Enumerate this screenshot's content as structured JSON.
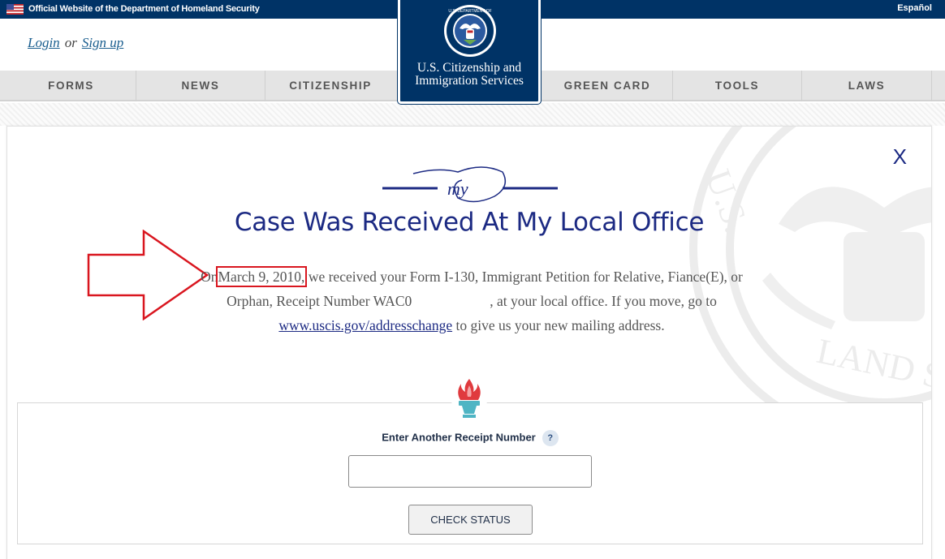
{
  "gov_banner": {
    "text": "Official Website of the Department of Homeland Security",
    "language_link": "Español"
  },
  "header": {
    "login": "Login",
    "or": "or",
    "signup": "Sign up"
  },
  "logo": {
    "line1": "U.S. Citizenship and",
    "line2": "Immigration Services"
  },
  "nav": {
    "items": [
      "FORMS",
      "NEWS",
      "CITIZENSHIP",
      "GREEN CARD",
      "TOOLS",
      "LAWS"
    ]
  },
  "case": {
    "close": "X",
    "title": "Case Was Received At My Local Office",
    "desc_on": "On",
    "date": "March 9, 2010,",
    "desc_part1": " we received your Form I-130, Immigrant Petition for Relative, Fiance(E), or Orphan, Receipt Number WAC0",
    "desc_part2": ", at your local office. If you move, go to ",
    "link": "www.uscis.gov/addresschange",
    "desc_part3": " to give us your new mailing address."
  },
  "receipt": {
    "label": "Enter Another Receipt Number",
    "help": "?",
    "input_value": "",
    "button": "CHECK STATUS"
  },
  "colors": {
    "navy": "#003366",
    "title_blue": "#1c2a83",
    "highlight_red": "#d9161f",
    "torch_flame": "#e03a3e",
    "torch_base": "#4fb5c4"
  }
}
